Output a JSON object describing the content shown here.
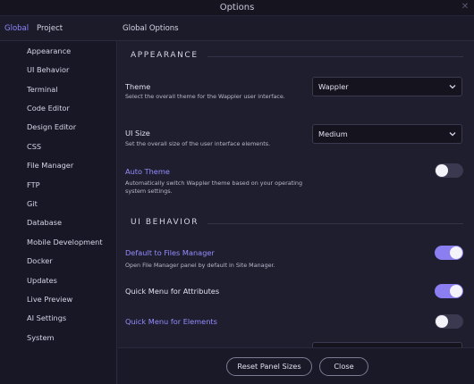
{
  "window": {
    "title": "Options",
    "close_icon": "close-icon"
  },
  "tabs": [
    {
      "label": "Global",
      "active": true
    },
    {
      "label": "Project",
      "active": false
    }
  ],
  "section_title": "Global Options",
  "sidebar": {
    "items": [
      {
        "label": "Appearance"
      },
      {
        "label": "UI Behavior"
      },
      {
        "label": "Terminal"
      },
      {
        "label": "Code Editor"
      },
      {
        "label": "Design Editor"
      },
      {
        "label": "CSS"
      },
      {
        "label": "File Manager"
      },
      {
        "label": "FTP"
      },
      {
        "label": "Git"
      },
      {
        "label": "Database"
      },
      {
        "label": "Mobile Development"
      },
      {
        "label": "Docker"
      },
      {
        "label": "Updates"
      },
      {
        "label": "Live Preview"
      },
      {
        "label": "AI Settings"
      },
      {
        "label": "System"
      }
    ]
  },
  "appearance": {
    "heading": "APPEARANCE",
    "theme": {
      "label": "Theme",
      "description": "Select the overall theme for the Wappler user interface.",
      "value": "Wappler"
    },
    "ui_size": {
      "label": "UI Size",
      "description": "Set the overall size of the user interface elements.",
      "value": "Medium"
    },
    "auto_theme": {
      "label": "Auto Theme",
      "description": "Automatically switch Wappler theme based on your operating system settings.",
      "enabled": false
    }
  },
  "ui_behavior": {
    "heading": "UI BEHAVIOR",
    "default_files_manager": {
      "label": "Default to Files Manager",
      "description": "Open File Manager panel by default in Site Manager.",
      "enabled": true
    },
    "quick_menu_attributes": {
      "label": "Quick Menu for Attributes",
      "enabled": true
    },
    "quick_menu_elements": {
      "label": "Quick Menu for Elements",
      "enabled": false
    }
  },
  "footer": {
    "reset_label": "Reset Panel Sizes",
    "close_label": "Close"
  },
  "colors": {
    "accent": "#8f86ff",
    "toggle_on": "#8a7ef0",
    "toggle_off": "#3a394f",
    "background": "#1f1e2e"
  }
}
